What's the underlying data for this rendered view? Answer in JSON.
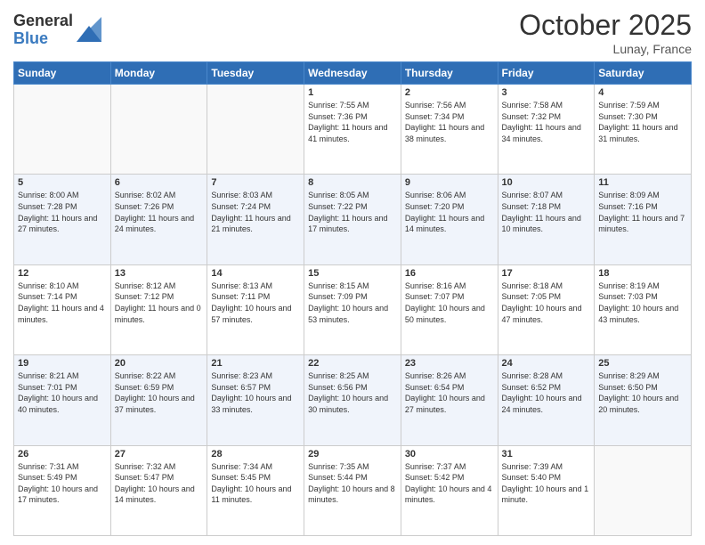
{
  "header": {
    "logo_general": "General",
    "logo_blue": "Blue",
    "month_title": "October 2025",
    "location": "Lunay, France"
  },
  "weekdays": [
    "Sunday",
    "Monday",
    "Tuesday",
    "Wednesday",
    "Thursday",
    "Friday",
    "Saturday"
  ],
  "weeks": [
    [
      {
        "day": "",
        "info": ""
      },
      {
        "day": "",
        "info": ""
      },
      {
        "day": "",
        "info": ""
      },
      {
        "day": "1",
        "info": "Sunrise: 7:55 AM\nSunset: 7:36 PM\nDaylight: 11 hours and 41 minutes."
      },
      {
        "day": "2",
        "info": "Sunrise: 7:56 AM\nSunset: 7:34 PM\nDaylight: 11 hours and 38 minutes."
      },
      {
        "day": "3",
        "info": "Sunrise: 7:58 AM\nSunset: 7:32 PM\nDaylight: 11 hours and 34 minutes."
      },
      {
        "day": "4",
        "info": "Sunrise: 7:59 AM\nSunset: 7:30 PM\nDaylight: 11 hours and 31 minutes."
      }
    ],
    [
      {
        "day": "5",
        "info": "Sunrise: 8:00 AM\nSunset: 7:28 PM\nDaylight: 11 hours and 27 minutes."
      },
      {
        "day": "6",
        "info": "Sunrise: 8:02 AM\nSunset: 7:26 PM\nDaylight: 11 hours and 24 minutes."
      },
      {
        "day": "7",
        "info": "Sunrise: 8:03 AM\nSunset: 7:24 PM\nDaylight: 11 hours and 21 minutes."
      },
      {
        "day": "8",
        "info": "Sunrise: 8:05 AM\nSunset: 7:22 PM\nDaylight: 11 hours and 17 minutes."
      },
      {
        "day": "9",
        "info": "Sunrise: 8:06 AM\nSunset: 7:20 PM\nDaylight: 11 hours and 14 minutes."
      },
      {
        "day": "10",
        "info": "Sunrise: 8:07 AM\nSunset: 7:18 PM\nDaylight: 11 hours and 10 minutes."
      },
      {
        "day": "11",
        "info": "Sunrise: 8:09 AM\nSunset: 7:16 PM\nDaylight: 11 hours and 7 minutes."
      }
    ],
    [
      {
        "day": "12",
        "info": "Sunrise: 8:10 AM\nSunset: 7:14 PM\nDaylight: 11 hours and 4 minutes."
      },
      {
        "day": "13",
        "info": "Sunrise: 8:12 AM\nSunset: 7:12 PM\nDaylight: 11 hours and 0 minutes."
      },
      {
        "day": "14",
        "info": "Sunrise: 8:13 AM\nSunset: 7:11 PM\nDaylight: 10 hours and 57 minutes."
      },
      {
        "day": "15",
        "info": "Sunrise: 8:15 AM\nSunset: 7:09 PM\nDaylight: 10 hours and 53 minutes."
      },
      {
        "day": "16",
        "info": "Sunrise: 8:16 AM\nSunset: 7:07 PM\nDaylight: 10 hours and 50 minutes."
      },
      {
        "day": "17",
        "info": "Sunrise: 8:18 AM\nSunset: 7:05 PM\nDaylight: 10 hours and 47 minutes."
      },
      {
        "day": "18",
        "info": "Sunrise: 8:19 AM\nSunset: 7:03 PM\nDaylight: 10 hours and 43 minutes."
      }
    ],
    [
      {
        "day": "19",
        "info": "Sunrise: 8:21 AM\nSunset: 7:01 PM\nDaylight: 10 hours and 40 minutes."
      },
      {
        "day": "20",
        "info": "Sunrise: 8:22 AM\nSunset: 6:59 PM\nDaylight: 10 hours and 37 minutes."
      },
      {
        "day": "21",
        "info": "Sunrise: 8:23 AM\nSunset: 6:57 PM\nDaylight: 10 hours and 33 minutes."
      },
      {
        "day": "22",
        "info": "Sunrise: 8:25 AM\nSunset: 6:56 PM\nDaylight: 10 hours and 30 minutes."
      },
      {
        "day": "23",
        "info": "Sunrise: 8:26 AM\nSunset: 6:54 PM\nDaylight: 10 hours and 27 minutes."
      },
      {
        "day": "24",
        "info": "Sunrise: 8:28 AM\nSunset: 6:52 PM\nDaylight: 10 hours and 24 minutes."
      },
      {
        "day": "25",
        "info": "Sunrise: 8:29 AM\nSunset: 6:50 PM\nDaylight: 10 hours and 20 minutes."
      }
    ],
    [
      {
        "day": "26",
        "info": "Sunrise: 7:31 AM\nSunset: 5:49 PM\nDaylight: 10 hours and 17 minutes."
      },
      {
        "day": "27",
        "info": "Sunrise: 7:32 AM\nSunset: 5:47 PM\nDaylight: 10 hours and 14 minutes."
      },
      {
        "day": "28",
        "info": "Sunrise: 7:34 AM\nSunset: 5:45 PM\nDaylight: 10 hours and 11 minutes."
      },
      {
        "day": "29",
        "info": "Sunrise: 7:35 AM\nSunset: 5:44 PM\nDaylight: 10 hours and 8 minutes."
      },
      {
        "day": "30",
        "info": "Sunrise: 7:37 AM\nSunset: 5:42 PM\nDaylight: 10 hours and 4 minutes."
      },
      {
        "day": "31",
        "info": "Sunrise: 7:39 AM\nSunset: 5:40 PM\nDaylight: 10 hours and 1 minute."
      },
      {
        "day": "",
        "info": ""
      }
    ]
  ]
}
